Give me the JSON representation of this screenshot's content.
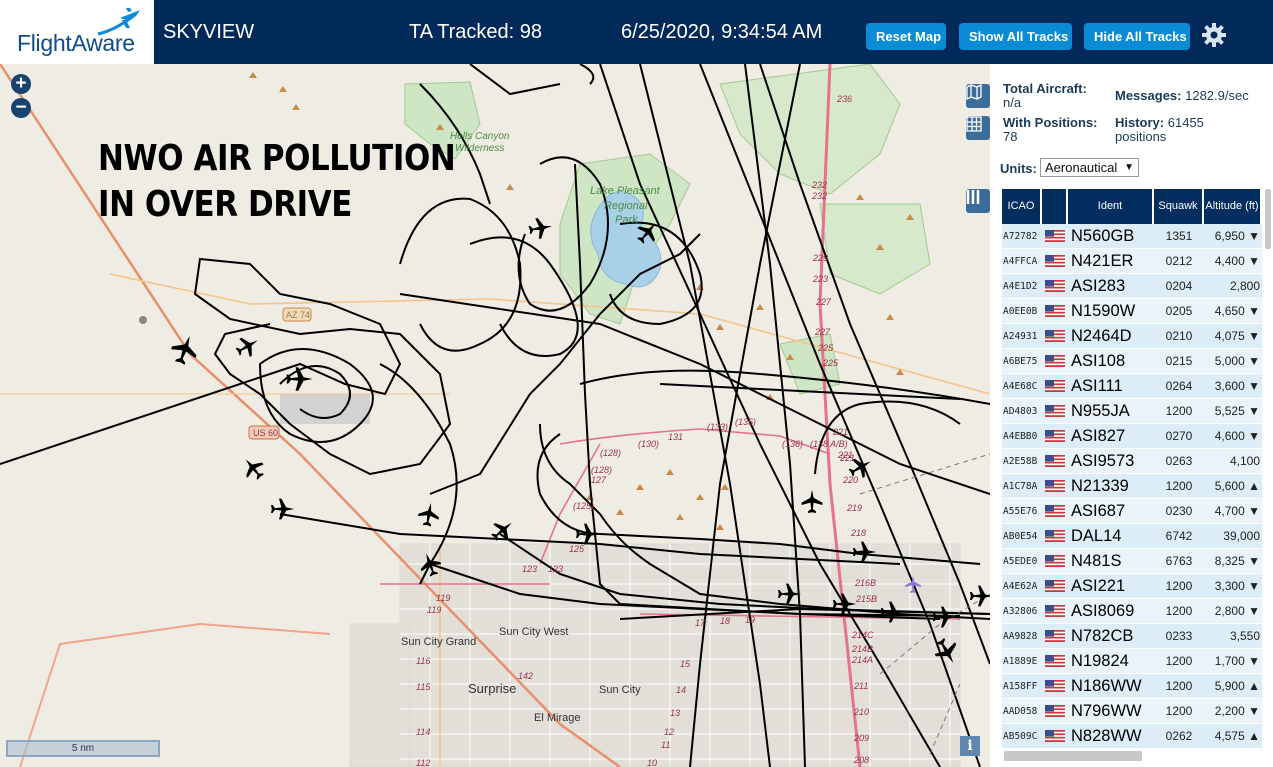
{
  "header": {
    "logo_text": "FlightAware",
    "site_name": "SKYVIEW",
    "ta_tracked": "TA Tracked: 98",
    "datetime": "6/25/2020, 9:34:54 AM",
    "buttons": {
      "reset_map": "Reset Map",
      "show_all_tracks": "Show All Tracks",
      "hide_all_tracks": "Hide All Tracks"
    },
    "settings_icon": "gear-icon"
  },
  "map": {
    "overlay_title_line1": "NWO AIR POLLUTION",
    "overlay_title_line2": "IN OVER DRIVE",
    "zoom_in": "+",
    "zoom_out": "−",
    "scale": "5 nm",
    "info": "i",
    "labels": {
      "hells_canyon": "Hells Canyon",
      "wilderness": "Wilderness",
      "lake_pleasant": "Lake Pleasant",
      "regional": "Regional",
      "park": "Park",
      "sun_city_grand": "Sun City Grand",
      "sun_city_west": "Sun City West",
      "surprise": "Surprise",
      "sun_city": "Sun City",
      "el_mirage": "El Mirage",
      "az74": "AZ 74",
      "us60": "US 60"
    },
    "route_numbers": [
      "236",
      "232",
      "232",
      "229",
      "223",
      "227",
      "227",
      "225",
      "225",
      "221",
      "221",
      "220",
      "219",
      "218",
      "(136)",
      "(138 A/B)",
      "(135)",
      "(133)",
      "131",
      "(130)",
      "(128)",
      "(128)",
      "127",
      "(125)",
      "125",
      "123",
      "123",
      "119",
      "119",
      "116",
      "115",
      "114",
      "112",
      "142",
      "17",
      "18",
      "19",
      "15",
      "14",
      "13",
      "12",
      "11",
      "10",
      "216B",
      "215B",
      "214C",
      "214B,",
      "214A",
      "211",
      "210",
      "209",
      "208",
      "221"
    ]
  },
  "panel": {
    "total_aircraft_label": "Total Aircraft:",
    "total_aircraft_value": "n/a",
    "with_positions_label": "With Positions:",
    "with_positions_value": "78",
    "messages_label": "Messages:",
    "messages_value": "1282.9/sec",
    "history_label": "History:",
    "history_value": "61455",
    "history_unit": "positions",
    "units_label": "Units:",
    "units_value": "Aeronautical",
    "columns": [
      "ICAO",
      "Ident",
      "Squawk",
      "Altitude (ft)"
    ],
    "rows": [
      {
        "icao": "A72782",
        "ident": "N560GB",
        "squawk": "1351",
        "alt": "6,950",
        "trend": "▼"
      },
      {
        "icao": "A4FFCA",
        "ident": "N421ER",
        "squawk": "0212",
        "alt": "4,400",
        "trend": "▼"
      },
      {
        "icao": "A4E1D2",
        "ident": "ASI283",
        "squawk": "0204",
        "alt": "2,800",
        "trend": ""
      },
      {
        "icao": "A0EE0B",
        "ident": "N1590W",
        "squawk": "0205",
        "alt": "4,650",
        "trend": "▼"
      },
      {
        "icao": "A24931",
        "ident": "N2464D",
        "squawk": "0210",
        "alt": "4,075",
        "trend": "▼"
      },
      {
        "icao": "A6BE75",
        "ident": "ASI108",
        "squawk": "0215",
        "alt": "5,000",
        "trend": "▼"
      },
      {
        "icao": "A4E68C",
        "ident": "ASI111",
        "squawk": "0264",
        "alt": "3,600",
        "trend": "▼"
      },
      {
        "icao": "AD4803",
        "ident": "N955JA",
        "squawk": "1200",
        "alt": "5,525",
        "trend": "▼"
      },
      {
        "icao": "A4EBB0",
        "ident": "ASI827",
        "squawk": "0270",
        "alt": "4,600",
        "trend": "▼"
      },
      {
        "icao": "A2E58B",
        "ident": "ASI9573",
        "squawk": "0263",
        "alt": "4,100",
        "trend": ""
      },
      {
        "icao": "A1C78A",
        "ident": "N21339",
        "squawk": "1200",
        "alt": "5,600",
        "trend": "▲"
      },
      {
        "icao": "A55E76",
        "ident": "ASI687",
        "squawk": "0230",
        "alt": "4,700",
        "trend": "▼"
      },
      {
        "icao": "AB0E54",
        "ident": "DAL14",
        "squawk": "6742",
        "alt": "39,000",
        "trend": ""
      },
      {
        "icao": "A5EDE0",
        "ident": "N481S",
        "squawk": "6763",
        "alt": "8,325",
        "trend": "▼"
      },
      {
        "icao": "A4E62A",
        "ident": "ASI221",
        "squawk": "1200",
        "alt": "3,300",
        "trend": "▼"
      },
      {
        "icao": "A32806",
        "ident": "ASI8069",
        "squawk": "1200",
        "alt": "2,800",
        "trend": "▼"
      },
      {
        "icao": "AA9828",
        "ident": "N782CB",
        "squawk": "0233",
        "alt": "3,550",
        "trend": ""
      },
      {
        "icao": "A1889E",
        "ident": "N19824",
        "squawk": "1200",
        "alt": "1,700",
        "trend": "▼"
      },
      {
        "icao": "A158FF",
        "ident": "N186WW",
        "squawk": "1200",
        "alt": "5,900",
        "trend": "▲"
      },
      {
        "icao": "AAD058",
        "ident": "N796WW",
        "squawk": "1200",
        "alt": "2,200",
        "trend": "▼"
      },
      {
        "icao": "AB509C",
        "ident": "N828WW",
        "squawk": "0262",
        "alt": "4,575",
        "trend": "▲"
      }
    ]
  },
  "colors": {
    "header_bg": "#012a5a",
    "button_bg": "#0a8bd6",
    "map_bg": "#efece4",
    "track": "#000000",
    "lake": "#a8d0e6",
    "interstate": "#e5738a",
    "table_header": "#022d5f"
  }
}
